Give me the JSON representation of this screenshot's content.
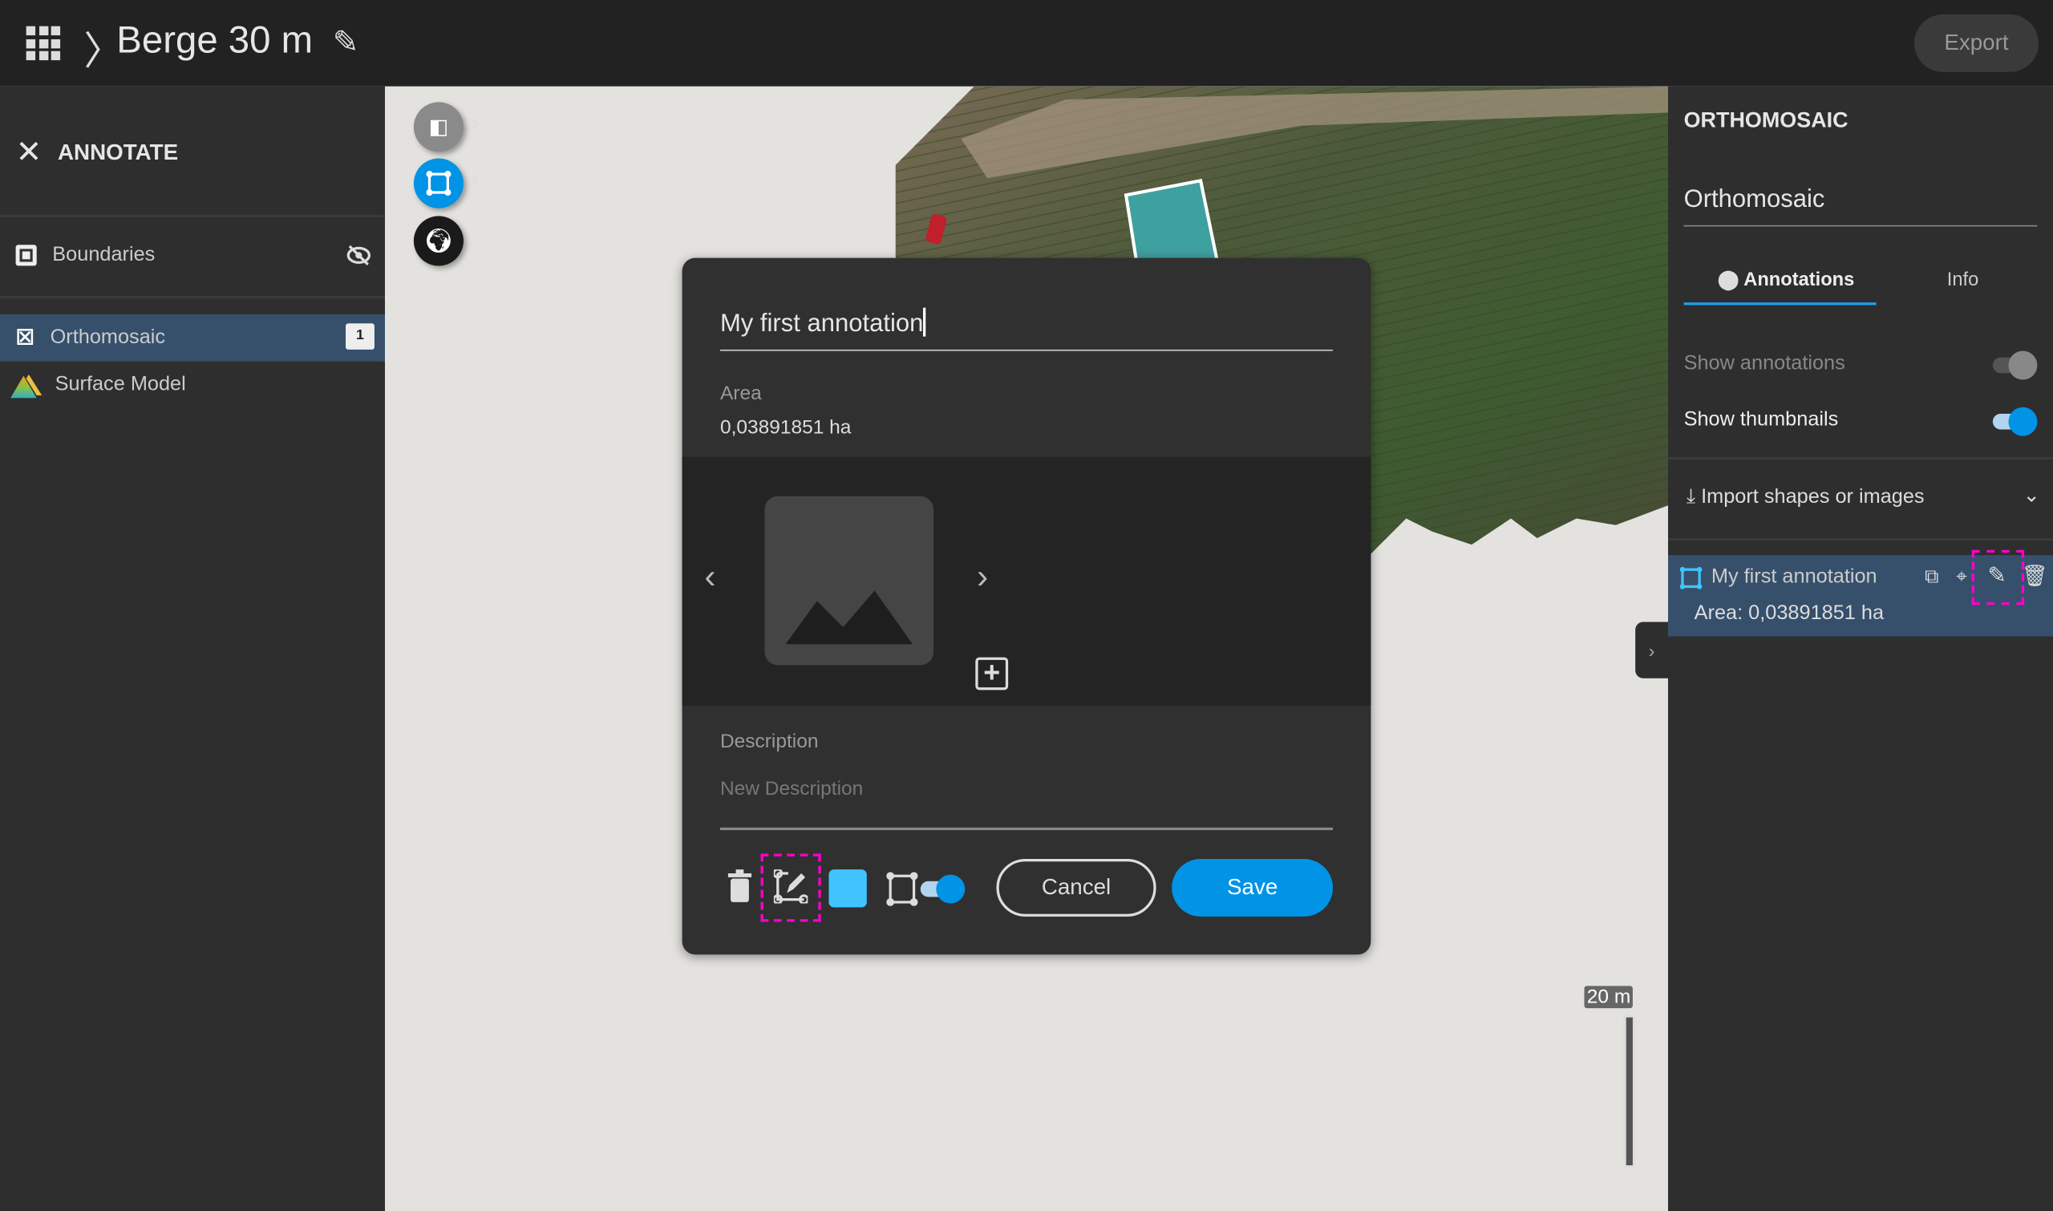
{
  "header": {
    "breadcrumb_sep": "〉",
    "project_title": "Berge 30 m",
    "export_label": "Export"
  },
  "left_panel": {
    "title": "ANNOTATE",
    "layers": [
      {
        "label": "Boundaries",
        "icon": "boundaries-icon",
        "status_icon": "eye-off-icon"
      },
      {
        "label": "Orthomosaic",
        "icon": "orthomosaic-icon",
        "badge": "1",
        "selected": true
      },
      {
        "label": "Surface Model",
        "icon": "surface-model-icon"
      }
    ]
  },
  "map": {
    "scale_label": "20 m",
    "tools": [
      "split-view-icon",
      "polygon-tool-icon",
      "globe-icon"
    ]
  },
  "dialog": {
    "name_value": "My first annotation",
    "area_label": "Area",
    "area_value": "0,03891851 ha",
    "description_label": "Description",
    "description_placeholder": "New Description",
    "cancel_label": "Cancel",
    "save_label": "Save",
    "color": "#40c4ff"
  },
  "right_panel": {
    "title": "ORTHOMOSAIC",
    "layer_select": "Orthomosaic",
    "tabs": [
      {
        "label": "Annotations",
        "active": true
      },
      {
        "label": "Info"
      }
    ],
    "show_annotations": {
      "label": "Show annotations",
      "on": true,
      "disabled": true
    },
    "show_thumbnails": {
      "label": "Show thumbnails",
      "on": true
    },
    "import_label": "Import shapes or images",
    "annotations": [
      {
        "name": "My first annotation",
        "area": "Area: 0,03891851 ha"
      }
    ]
  },
  "colors": {
    "accent": "#0093e6",
    "highlight": "#ff00cc",
    "selected_row": "#36506c"
  }
}
